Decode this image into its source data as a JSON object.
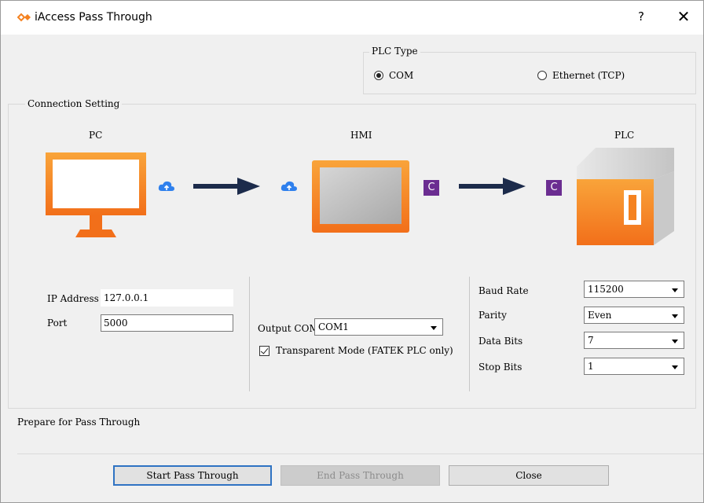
{
  "window": {
    "title": "iAccess  Pass Through",
    "help_label": "?",
    "close_label": "✕"
  },
  "plc_type": {
    "group_label": "PLC Type",
    "options": [
      {
        "label": "COM",
        "selected": true
      },
      {
        "label": "Ethernet (TCP)",
        "selected": false
      }
    ]
  },
  "connection": {
    "group_label": "Connection Setting",
    "nodes": {
      "pc": "PC",
      "hmi": "HMI",
      "plc": "PLC"
    },
    "badge_c": "C"
  },
  "ethernet": {
    "ip_label": "IP Address",
    "ip_value": "127.0.0.1",
    "port_label": "Port",
    "port_value": "5000"
  },
  "output": {
    "label": "Output COM",
    "value": "COM1",
    "transparent_label": "Transparent Mode (FATEK PLC only)",
    "transparent_checked": true
  },
  "serial": {
    "baud_label": "Baud Rate",
    "baud_value": "115200",
    "parity_label": "Parity",
    "parity_value": "Even",
    "databits_label": "Data Bits",
    "databits_value": "7",
    "stopbits_label": "Stop Bits",
    "stopbits_value": "1"
  },
  "status_text": "Prepare for Pass Through",
  "buttons": {
    "start": "Start Pass Through",
    "end": "End Pass Through",
    "close": "Close"
  },
  "colors": {
    "orange": "#f58220",
    "arrow": "#1c2b4b",
    "cloud": "#2f80ed",
    "badge": "#6b2d91",
    "focus": "#2f73c3"
  },
  "icons": {
    "app": "link-diamond-icon",
    "pc": "monitor-icon",
    "hmi": "hmi-panel-icon",
    "plc": "plc-box-icon",
    "cloud": "cloud-upload-icon",
    "com": "com-port-icon"
  }
}
